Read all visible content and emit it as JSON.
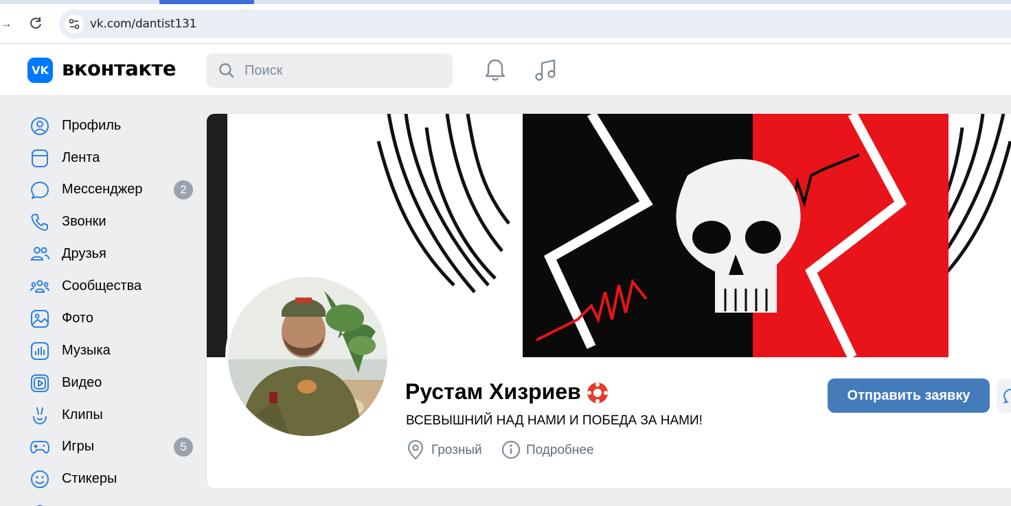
{
  "browser": {
    "url": "vk.com/dantist131"
  },
  "header": {
    "logo_badge": "VK",
    "logo_text": "вконтакте",
    "search_placeholder": "Поиск",
    "icons": [
      "bell-icon",
      "music-icon"
    ]
  },
  "sidebar": {
    "items": [
      {
        "label": "Профиль",
        "icon": "profile-icon"
      },
      {
        "label": "Лента",
        "icon": "feed-icon"
      },
      {
        "label": "Мессенджер",
        "icon": "messenger-icon",
        "badge": "2"
      },
      {
        "label": "Звонки",
        "icon": "phone-icon"
      },
      {
        "label": "Друзья",
        "icon": "friends-icon"
      },
      {
        "label": "Сообщества",
        "icon": "communities-icon"
      },
      {
        "label": "Фото",
        "icon": "photo-icon"
      },
      {
        "label": "Музыка",
        "icon": "music-icon"
      },
      {
        "label": "Видео",
        "icon": "video-icon"
      },
      {
        "label": "Клипы",
        "icon": "clips-icon"
      },
      {
        "label": "Игры",
        "icon": "games-icon",
        "badge": "5"
      },
      {
        "label": "Стикеры",
        "icon": "stickers-icon"
      }
    ]
  },
  "profile": {
    "name": "Рустам Хизриев",
    "status": "ВСЕВЫШНИЙ НАД НАМИ И ПОБЕДА ЗА НАМИ!",
    "city": "Грозный",
    "more_label": "Подробнее",
    "add_friend_label": "Отправить заявку"
  },
  "colors": {
    "vk_blue": "#0077ff",
    "button_blue": "#447bba",
    "badge_gray": "#99a2ad",
    "icon_blue": "#2d81e0",
    "secondary_text": "#626d7a"
  }
}
